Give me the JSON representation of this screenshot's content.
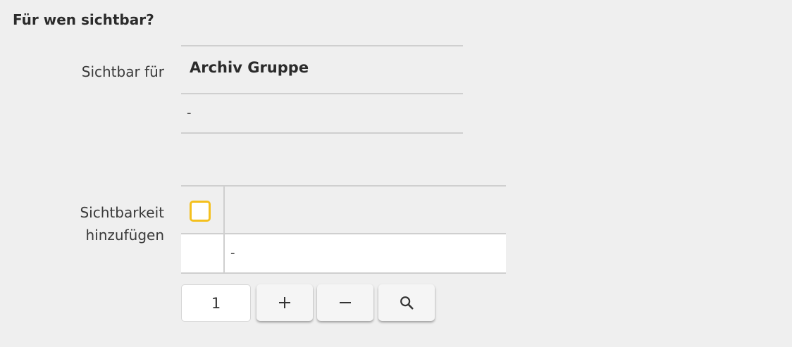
{
  "section": {
    "title": "Für wen sichtbar?"
  },
  "visible_for": {
    "label": "Sichtbar für",
    "value": "Archiv Gruppe",
    "subvalue": "-"
  },
  "add_visibility": {
    "label_line1": "Sichtbarkeit",
    "label_line2": "hinzufügen",
    "row_value": "-",
    "checkbox_color": "#f4c01e"
  },
  "pagination": {
    "page": "1",
    "add_symbol": "+",
    "remove_symbol": "−"
  },
  "icons": {
    "add": "plus-icon",
    "remove": "minus-icon",
    "search": "search-icon"
  }
}
